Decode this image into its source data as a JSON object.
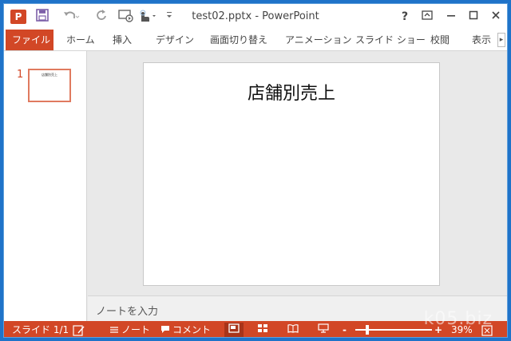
{
  "titlebar": {
    "app_icon": "P",
    "title": "test02.pptx - PowerPoint",
    "help": "?",
    "qat_icons": [
      "save-icon",
      "undo-icon",
      "redo-icon",
      "present-icon",
      "touch-icon",
      "customize-icon"
    ]
  },
  "tabs": [
    {
      "label": "ファイル"
    },
    {
      "label": "ホーム"
    },
    {
      "label": "挿入"
    },
    {
      "label": "デザイン"
    },
    {
      "label": "画面切り替え"
    },
    {
      "label": "アニメーション"
    },
    {
      "label": "スライド ショー"
    },
    {
      "label": "校閲"
    },
    {
      "label": "表示"
    }
  ],
  "thumbnails": {
    "number": "1",
    "title": "店舗別売上"
  },
  "slide": {
    "title": "店舗別売上"
  },
  "notes": {
    "placeholder": "ノートを入力"
  },
  "statusbar": {
    "slide_info": "スライド 1/1",
    "notes_label": "ノート",
    "comments_label": "コメント",
    "zoom_percent": "39%",
    "zoom_value": 39,
    "watermark": "k05.biz"
  },
  "colors": {
    "accent": "#d24726",
    "window_border": "#1f73c9"
  }
}
